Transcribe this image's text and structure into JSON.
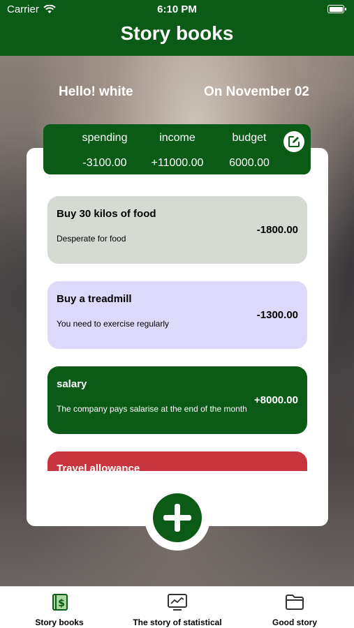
{
  "status": {
    "carrier": "Carrier",
    "time": "6:10 PM"
  },
  "header": {
    "title": "Story books"
  },
  "greeting": {
    "hello": "Hello! white",
    "date": "On November 02"
  },
  "summary": {
    "spending_label": "spending",
    "spending_value": "-3100.00",
    "income_label": "income",
    "income_value": "+11000.00",
    "budget_label": "budget",
    "budget_value": "6000.00"
  },
  "items": [
    {
      "title": "Buy 30 kilos of food",
      "desc": "Desperate for food",
      "amount": "-1800.00",
      "bg": "#d5dbd3",
      "fg": "#000000"
    },
    {
      "title": "Buy a treadmill",
      "desc": "You need to exercise regularly",
      "amount": "-1300.00",
      "bg": "#ddd9fb",
      "fg": "#000000"
    },
    {
      "title": "salary",
      "desc": "The company pays salarise at the end of the month",
      "amount": "+8000.00",
      "bg": "#0b5b16",
      "fg": "#ffffff"
    },
    {
      "title": "Travel allowance",
      "desc": "",
      "amount": "",
      "bg": "#c9353f",
      "fg": "#ffffff"
    }
  ],
  "tabs": [
    {
      "label": "Story books"
    },
    {
      "label": "The story of statistical"
    },
    {
      "label": "Good story"
    }
  ],
  "colors": {
    "primary": "#0b5b16",
    "danger": "#c9353f"
  }
}
